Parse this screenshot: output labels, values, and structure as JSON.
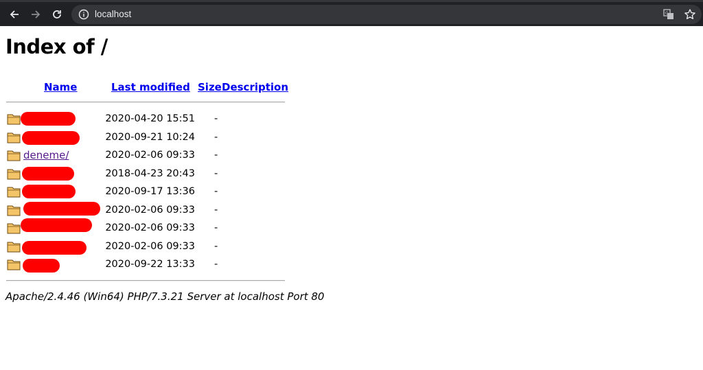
{
  "browser": {
    "url": "localhost",
    "icons": {
      "back": "arrow-left-icon",
      "forward": "arrow-right-icon",
      "reload": "reload-icon",
      "info": "info-icon",
      "translate": "translate-icon",
      "bookmark": "star-icon"
    }
  },
  "page": {
    "title": "Index of /",
    "columns": {
      "name": "Name",
      "last_modified": "Last modified",
      "size": "Size",
      "description": "Description"
    },
    "rows": [
      {
        "name": "",
        "redacted": true,
        "date": "2020-04-20 15:51",
        "size": "-"
      },
      {
        "name": "",
        "redacted": true,
        "date": "2020-09-21 10:24",
        "size": "-"
      },
      {
        "name": "deneme/",
        "redacted": false,
        "date": "2020-02-06 09:33",
        "size": "-"
      },
      {
        "name": "",
        "redacted": true,
        "date": "2018-04-23 20:43",
        "size": "-"
      },
      {
        "name": "",
        "redacted": true,
        "date": "2020-09-17 13:36",
        "size": "-"
      },
      {
        "name": "",
        "redacted": true,
        "date": "2020-02-06 09:33",
        "size": "-"
      },
      {
        "name": "",
        "redacted": true,
        "date": "2020-02-06 09:33",
        "size": "-"
      },
      {
        "name": "",
        "redacted": true,
        "date": "2020-02-06 09:33",
        "size": "-"
      },
      {
        "name": "",
        "redacted": true,
        "date": "2020-09-22 13:33",
        "size": "-"
      }
    ],
    "footer": "Apache/2.4.46 (Win64) PHP/7.3.21 Server at localhost Port 80"
  },
  "colors": {
    "chrome_bg": "#202124",
    "omnibox_bg": "#35363a",
    "link": "#0000ee",
    "visited_link": "#551a8b",
    "redaction": "#ff0000",
    "folder": "#f4c468"
  }
}
